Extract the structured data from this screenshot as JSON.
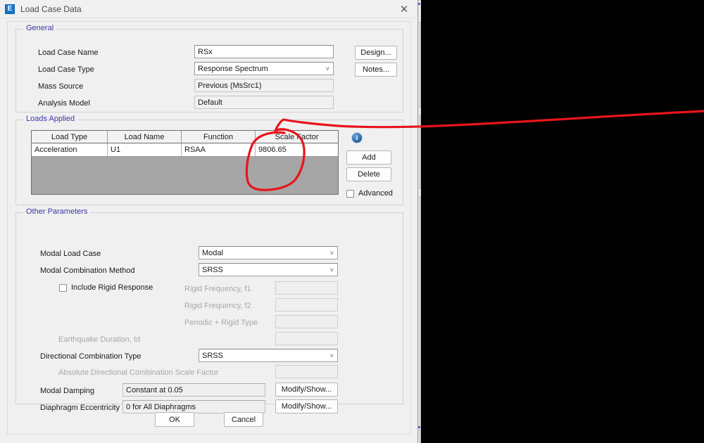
{
  "window": {
    "title": "Load Case Data",
    "app_icon_letter": "E",
    "close_icon": "close-icon"
  },
  "general": {
    "legend": "General",
    "rows": [
      {
        "label": "Load Case Name",
        "value": "RSx",
        "kind": "text"
      },
      {
        "label": "Load Case Type",
        "value": "Response Spectrum",
        "kind": "combo"
      },
      {
        "label": "Mass Source",
        "value": "Previous  (MsSrc1)",
        "kind": "readonly"
      },
      {
        "label": "Analysis Model",
        "value": "Default",
        "kind": "readonly"
      }
    ],
    "design_button": "Design...",
    "notes_button": "Notes..."
  },
  "loads_applied": {
    "legend": "Loads Applied",
    "columns": [
      "Load Type",
      "Load Name",
      "Function",
      "Scale Factor"
    ],
    "rows": [
      {
        "load_type": "Acceleration",
        "load_name": "U1",
        "function": "RSAA",
        "scale_factor": "9806.65"
      }
    ],
    "add_button": "Add",
    "delete_button": "Delete",
    "advanced_checkbox": "Advanced",
    "advanced_checked": false,
    "info_icon": "info-icon",
    "info_icon_letter": "i"
  },
  "other_parameters": {
    "legend": "Other Parameters",
    "modal_load_case": {
      "label": "Modal Load Case",
      "value": "Modal"
    },
    "modal_combination_method": {
      "label": "Modal Combination Method",
      "value": "SRSS"
    },
    "include_rigid_response": {
      "label": "Include Rigid Response",
      "checked": false
    },
    "rigid_frequency_f1": {
      "label": "Rigid Frequency, f1",
      "value": ""
    },
    "rigid_frequency_f2": {
      "label": "Rigid Frequency, f2",
      "value": ""
    },
    "periodic_rigid_type": {
      "label": "Periodic + Rigid Type",
      "value": ""
    },
    "earthquake_duration": {
      "label": "Earthquake Duration, td",
      "value": ""
    },
    "directional_combination_type": {
      "label": "Directional Combination Type",
      "value": "SRSS"
    },
    "absolute_directional_scale_factor": {
      "label": "Absolute Directional Combination Scale Factor",
      "value": ""
    },
    "modal_damping": {
      "label": "Modal Damping",
      "value": "Constant at 0.05",
      "button": "Modify/Show..."
    },
    "diaphragm_eccentricity": {
      "label": "Diaphragm Eccentricity",
      "value": "0 for All Diaphragms",
      "button": "Modify/Show..."
    }
  },
  "footer": {
    "ok_button": "OK",
    "cancel_button": "Cancel"
  },
  "annotation": {
    "color": "#e8141b",
    "shape": "hand-drawn-circle-with-pointer-line",
    "target": "Scale Factor column"
  },
  "colors": {
    "group_legend": "#3b36a8",
    "dialog_bg": "#f0f0f0",
    "table_empty": "#a6a6a6",
    "app_icon": "#1573c6",
    "annotation_red": "#e8141b"
  }
}
